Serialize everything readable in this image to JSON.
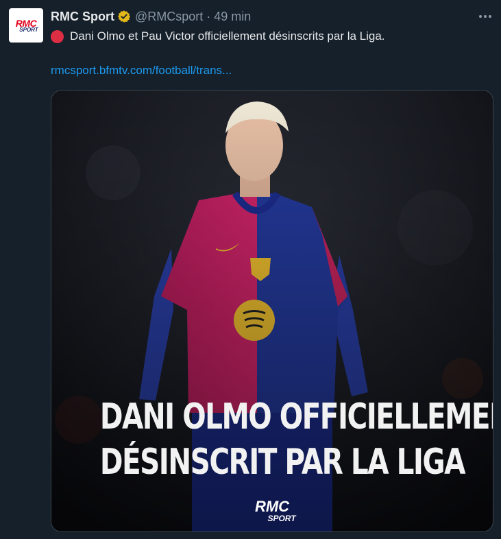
{
  "tweet": {
    "display_name": "RMC Sport",
    "handle": "@RMCsport",
    "separator": "·",
    "time": "49 min",
    "text": "Dani Olmo et Pau Victor officiellement désinscrits par la Liga.",
    "link": "rmcsport.bfmtv.com/football/trans...",
    "avatar_logo_top": "RMC",
    "avatar_logo_bottom": "SPORT"
  },
  "media": {
    "headline_line1": "DANI OLMO OFFICIELLEMENT",
    "headline_line2": "DÉSINSCRIT PAR LA LIGA",
    "logo_top": "RMC",
    "logo_bottom": "SPORT"
  },
  "icons": {
    "verified": "verified-badge-gold",
    "more": "more-horizontal",
    "emoji": "red-circle"
  },
  "colors": {
    "background": "#15202b",
    "text": "#e7e9ea",
    "muted": "#8b98a5",
    "link": "#1d9bf0",
    "verified": "#e2b719",
    "red_circle": "#dd2e44"
  }
}
